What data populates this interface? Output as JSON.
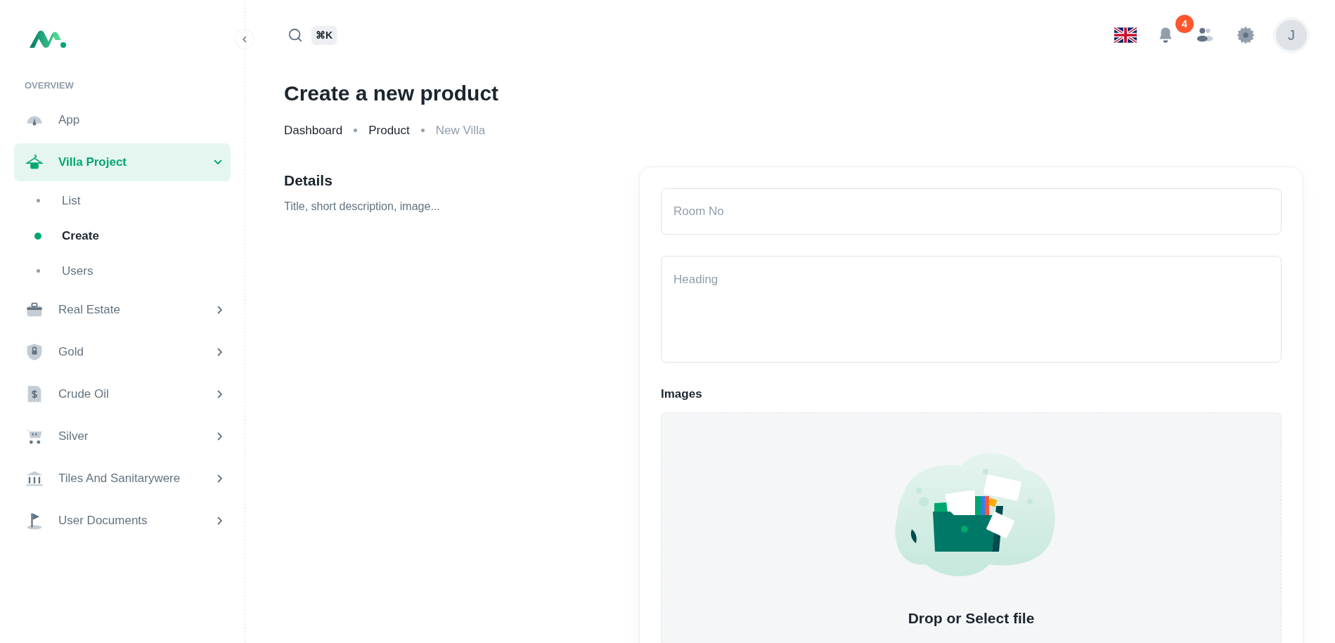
{
  "sidebar": {
    "section_label": "OVERVIEW",
    "items": [
      {
        "label": "App",
        "kind": "link",
        "selected": false
      },
      {
        "label": "Villa Project",
        "kind": "group",
        "selected": true,
        "expanded": true,
        "children": [
          {
            "label": "List",
            "selected": false
          },
          {
            "label": "Create",
            "selected": true
          },
          {
            "label": "Users",
            "selected": false
          }
        ]
      },
      {
        "label": "Real Estate",
        "kind": "group",
        "selected": false,
        "expanded": false
      },
      {
        "label": "Gold",
        "kind": "group",
        "selected": false,
        "expanded": false
      },
      {
        "label": "Crude Oil",
        "kind": "group",
        "selected": false,
        "expanded": false
      },
      {
        "label": "Silver",
        "kind": "group",
        "selected": false,
        "expanded": false
      },
      {
        "label": "Tiles And Sanitarywere",
        "kind": "group",
        "selected": false,
        "expanded": false
      },
      {
        "label": "User Documents",
        "kind": "group",
        "selected": false,
        "expanded": false
      }
    ]
  },
  "topbar": {
    "shortcut": "⌘K",
    "notifications": "4",
    "avatar": "J"
  },
  "page": {
    "title": "Create a new product",
    "breadcrumbs": [
      {
        "label": "Dashboard",
        "current": false
      },
      {
        "label": "Product",
        "current": false
      },
      {
        "label": "New Villa",
        "current": true
      }
    ],
    "section": {
      "title": "Details",
      "subtitle": "Title, short description, image..."
    },
    "form": {
      "room_no": {
        "placeholder": "Room No"
      },
      "heading": {
        "placeholder": "Heading"
      },
      "images_label": "Images",
      "dropzone_text": "Drop or Select file"
    }
  }
}
